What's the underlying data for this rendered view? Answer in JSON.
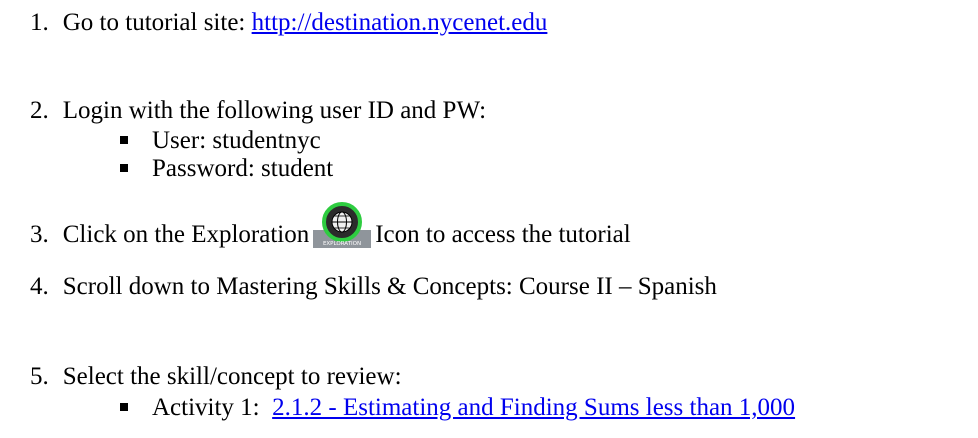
{
  "steps": [
    {
      "number": "1.",
      "text": "Go to tutorial site: ",
      "link": "http://destination.nycenet.edu"
    },
    {
      "number": "2.",
      "text": "Login with the following user ID and PW:",
      "bullets": [
        "User: studentnyc",
        "Password: student"
      ]
    },
    {
      "number": "3.",
      "text_before": "Click on the Exploration",
      "icon_label": "EXPLORATION",
      "text_after": "Icon to access the tutorial"
    },
    {
      "number": "4.",
      "text": "Scroll down to Mastering Skills & Concepts: Course II – Spanish"
    },
    {
      "number": "5.",
      "text": "Select the skill/concept to review:",
      "bullet_prefix": "Activity 1:",
      "bullet_link": "2.1.2 - Estimating and Finding Sums less than 1,000"
    }
  ],
  "colors": {
    "link": "#0000ee",
    "icon_ring": "#2ecc40",
    "icon_bg": "#9aa0a6"
  },
  "icons": {
    "exploration": "globe-icon"
  }
}
